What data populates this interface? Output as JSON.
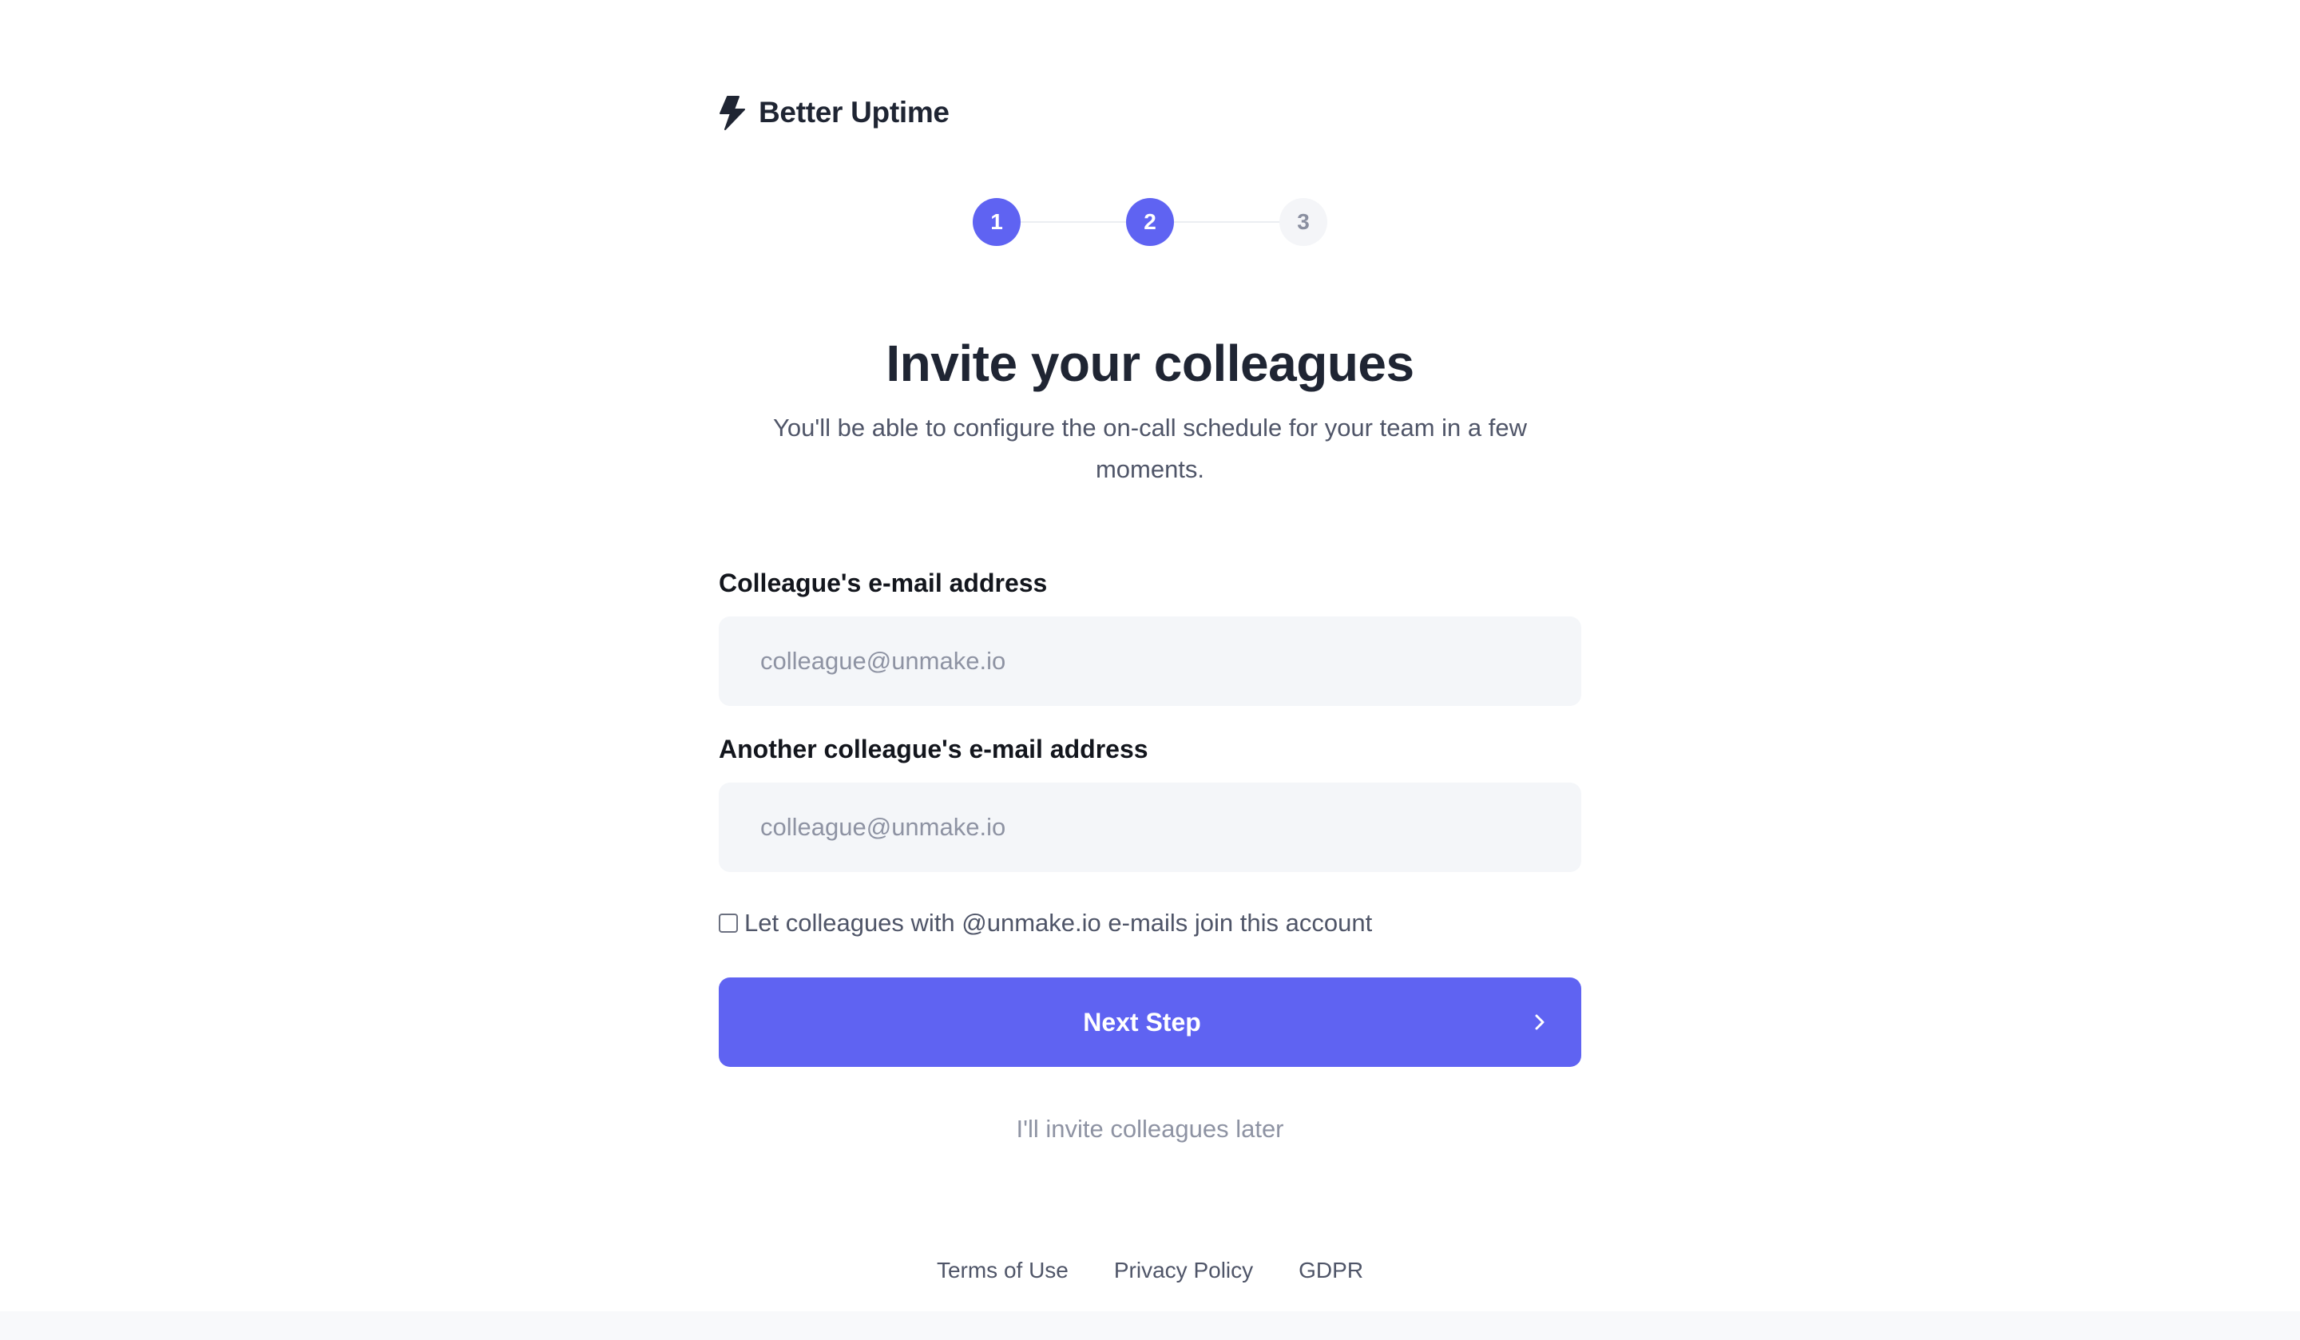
{
  "brand": {
    "name": "Better Uptime",
    "icon": "lightning-bolt-icon"
  },
  "stepper": {
    "steps": [
      {
        "label": "1",
        "state": "done"
      },
      {
        "label": "2",
        "state": "active"
      },
      {
        "label": "3",
        "state": "pending"
      }
    ],
    "current_step": 2,
    "total_steps": 3
  },
  "main": {
    "title": "Invite your colleagues",
    "subtitle_line1": "You'll be able to configure the on-call schedule for your team in a few",
    "subtitle_line2": "moments."
  },
  "form": {
    "email1": {
      "label": "Colleague's e-mail address",
      "placeholder": "colleague@unmake.io",
      "value": ""
    },
    "email2": {
      "label": "Another colleague's e-mail address",
      "placeholder": "colleague@unmake.io",
      "value": ""
    },
    "domain_join": {
      "label": "Let colleagues with @unmake.io e-mails join this account",
      "checked": false
    },
    "next_button": {
      "label": "Next Step",
      "icon": "chevron-right-icon"
    },
    "skip_link": "I'll invite colleagues later"
  },
  "footer": {
    "links": [
      "Terms of Use",
      "Privacy Policy",
      "GDPR"
    ]
  },
  "colors": {
    "accent": "#5f63f2",
    "text_dark": "#1f2533",
    "text_muted": "#4f5568",
    "placeholder": "#8e93a3",
    "input_bg": "#f4f6f9"
  }
}
